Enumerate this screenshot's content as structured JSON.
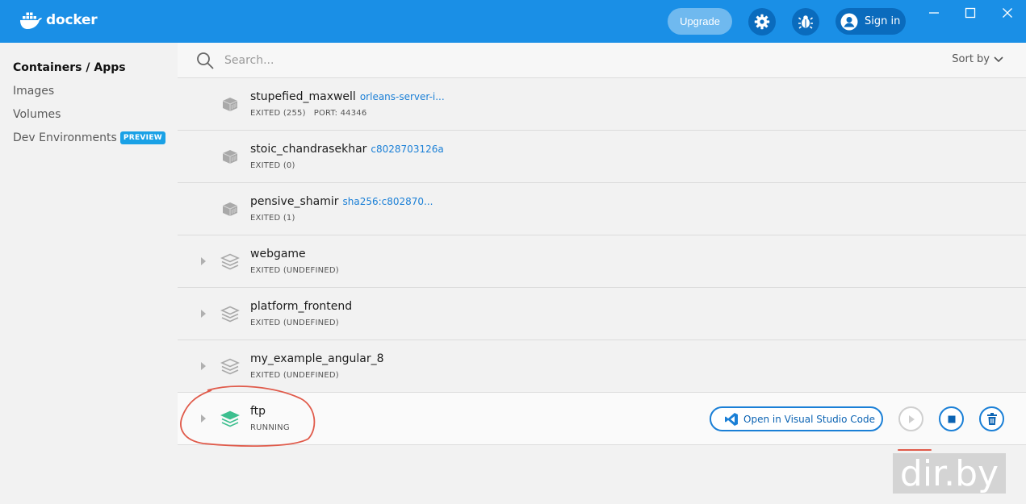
{
  "app": {
    "logo_text": "docker"
  },
  "titlebar": {
    "upgrade_label": "Upgrade",
    "signin_label": "Sign in"
  },
  "sidebar": {
    "items": [
      {
        "label": "Containers / Apps",
        "active": true
      },
      {
        "label": "Images"
      },
      {
        "label": "Volumes"
      },
      {
        "label": "Dev Environments",
        "badge": "PREVIEW"
      }
    ]
  },
  "search": {
    "placeholder": "Search...",
    "sort_label": "Sort by"
  },
  "rows": [
    {
      "name": "stupefied_maxwell",
      "link": "orleans-server-i...",
      "status": "EXITED (255)",
      "port": "PORT: 44346",
      "type": "container"
    },
    {
      "name": "stoic_chandrasekhar",
      "link": "c8028703126a",
      "status": "EXITED (0)",
      "type": "container"
    },
    {
      "name": "pensive_shamir",
      "link": "sha256:c802870...",
      "status": "EXITED (1)",
      "type": "container"
    },
    {
      "name": "webgame",
      "status": "EXITED (UNDEFINED)",
      "type": "app"
    },
    {
      "name": "platform_frontend",
      "status": "EXITED (UNDEFINED)",
      "type": "app"
    },
    {
      "name": "my_example_angular_8",
      "status": "EXITED (UNDEFINED)",
      "type": "app"
    },
    {
      "name": "ftp",
      "status": "RUNNING",
      "type": "app-running"
    }
  ],
  "actions": {
    "open_vscode_label": "Open in Visual Studio Code"
  },
  "watermark": "dir.by",
  "colors": {
    "brand": "#1a8fe6",
    "accent": "#1a7fd6",
    "running": "#3dbf8f",
    "annotation": "#e05a4a"
  }
}
